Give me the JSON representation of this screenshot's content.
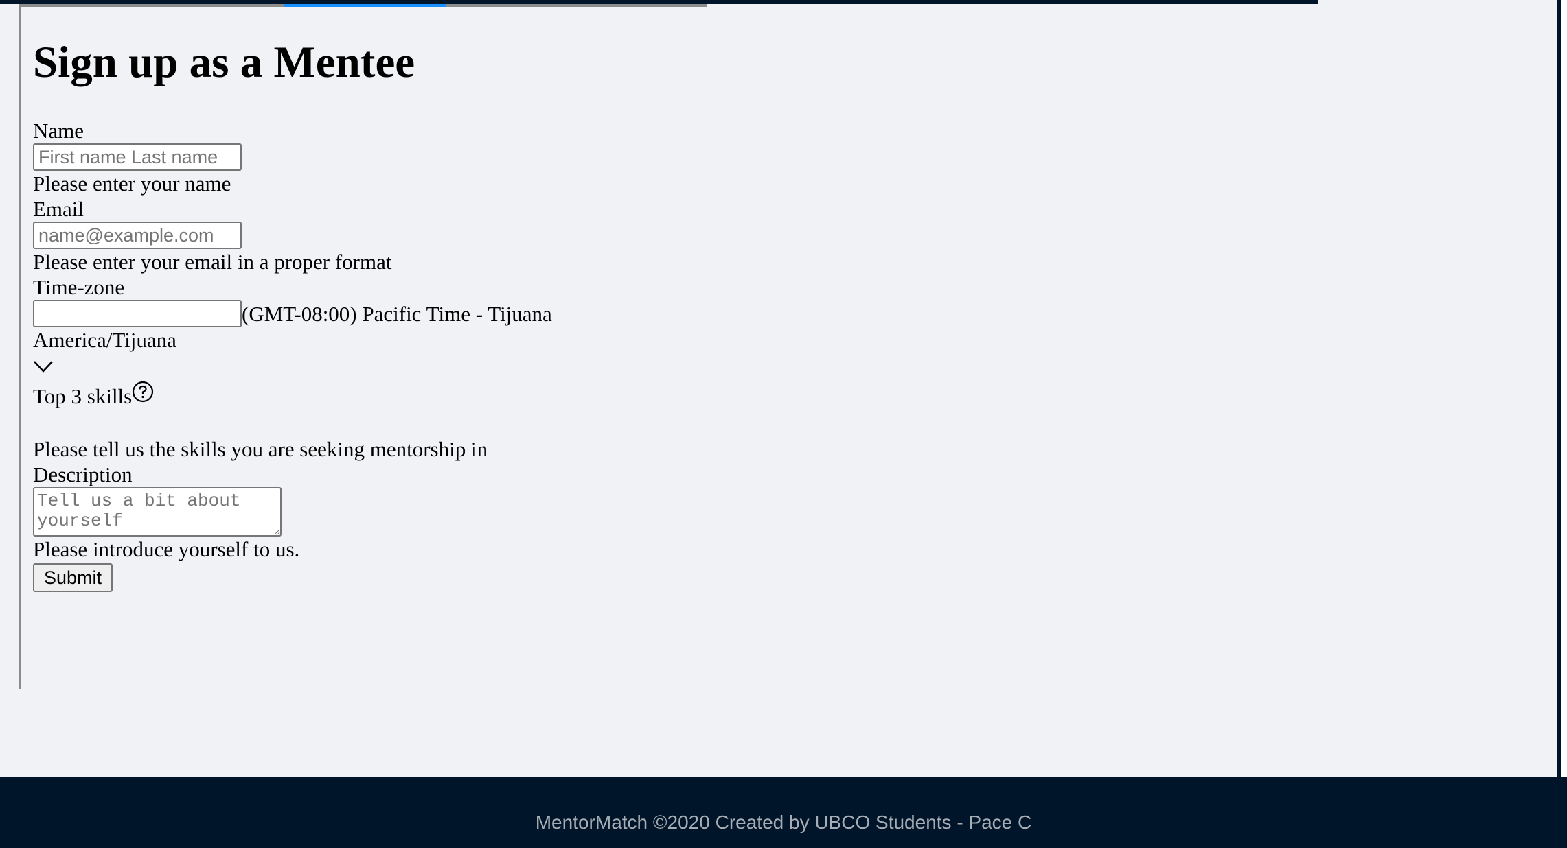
{
  "page": {
    "title": "Sign up as a Mentee"
  },
  "form": {
    "name": {
      "label": "Name",
      "placeholder": "First name Last name",
      "hint": "Please enter your name"
    },
    "email": {
      "label": "Email",
      "placeholder": "name@example.com",
      "hint": "Please enter your email in a proper format"
    },
    "timezone": {
      "label": "Time-zone",
      "value": "",
      "display_text": "(GMT-08:00) Pacific Time - Tijuana",
      "zone_name": "America/Tijuana",
      "expand_icon": "chevron-down-icon"
    },
    "skills": {
      "label": "Top 3 skills",
      "help_icon": "question-circle-icon",
      "hint": "Please tell us the skills you are seeking mentorship in"
    },
    "description": {
      "label": "Description",
      "placeholder": "Tell us a bit about yourself",
      "hint": "Please introduce yourself to us."
    },
    "submit_label": "Submit"
  },
  "footer": {
    "text": "MentorMatch ©2020 Created by UBCO Students - Pace C"
  },
  "colors": {
    "header_bg": "#001529",
    "page_bg": "#f0f2f5",
    "active_tab": "#1890ff",
    "footer_text": "#a6adb4"
  }
}
